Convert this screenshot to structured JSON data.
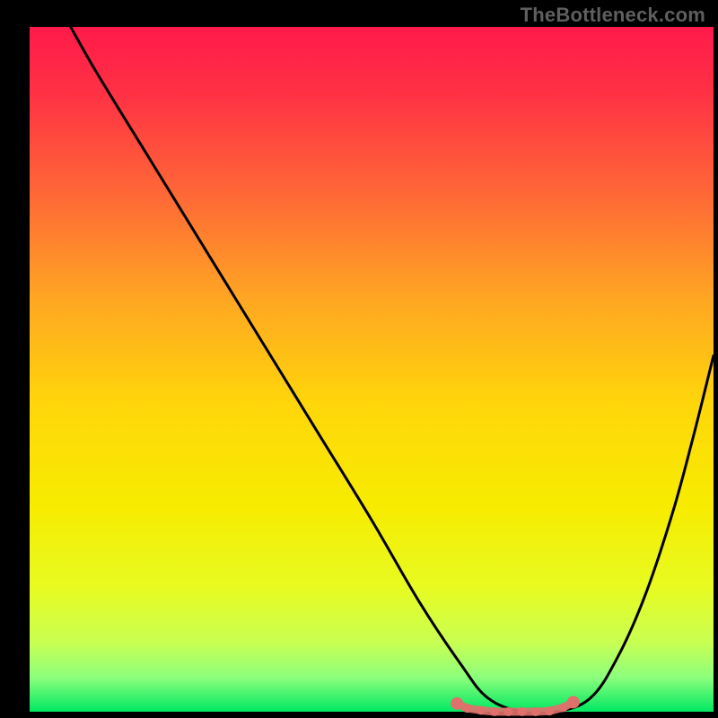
{
  "watermark": "TheBottleneck.com",
  "chart_data": {
    "type": "line",
    "title": "",
    "xlabel": "",
    "ylabel": "",
    "xlim": [
      0,
      100
    ],
    "ylim": [
      0,
      100
    ],
    "grid": false,
    "legend": false,
    "background_gradient": {
      "stops": [
        {
          "offset": 0.0,
          "color": "#ff1a4a"
        },
        {
          "offset": 0.1,
          "color": "#ff3244"
        },
        {
          "offset": 0.25,
          "color": "#ff6a36"
        },
        {
          "offset": 0.4,
          "color": "#ffa722"
        },
        {
          "offset": 0.55,
          "color": "#ffd60a"
        },
        {
          "offset": 0.7,
          "color": "#f7ec00"
        },
        {
          "offset": 0.82,
          "color": "#e7fb22"
        },
        {
          "offset": 0.9,
          "color": "#c8ff53"
        },
        {
          "offset": 0.95,
          "color": "#8cff7c"
        },
        {
          "offset": 1.0,
          "color": "#00e863"
        }
      ]
    },
    "series": [
      {
        "name": "bottleneck-curve",
        "type": "curve",
        "x": [
          6,
          10,
          18,
          26,
          34,
          42,
          50,
          57,
          63,
          67,
          72,
          77,
          82,
          86,
          90,
          94,
          97,
          100
        ],
        "values": [
          100,
          93,
          80,
          67,
          54,
          41,
          28,
          16,
          7,
          2,
          0,
          0,
          2,
          8,
          17,
          29,
          40,
          52
        ]
      },
      {
        "name": "optimal-band-markers",
        "type": "markers",
        "x": [
          62.5,
          64,
          66,
          68,
          70,
          72,
          74,
          76,
          78,
          79.5
        ],
        "values": [
          1.2,
          0.5,
          0.2,
          0,
          0,
          0,
          0,
          0.1,
          0.6,
          1.4
        ],
        "marker_color": "#e0706c",
        "endpoint_radius": 7,
        "mid_radius": 5
      }
    ]
  }
}
